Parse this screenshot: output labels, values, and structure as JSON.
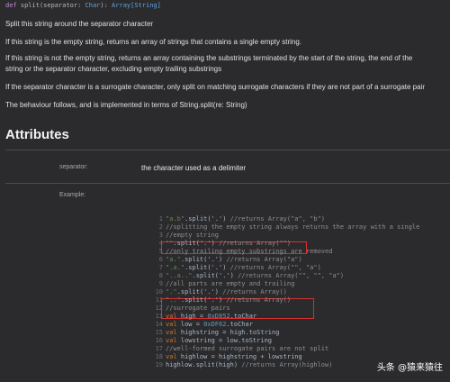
{
  "signature": {
    "keyword": "def",
    "name": "split(separator:",
    "type_a": "Char",
    "middle": "):",
    "type_b": "Array[String]"
  },
  "description": [
    "Split this string around the separator character",
    "If this string is the empty string, returns an array of strings that contains a single empty string.",
    "If this string is not the empty string, returns an array containing the substrings terminated by the start of the string, the end of the",
    "string or the separator character, excluding empty trailing substrings",
    "If the separator character is a surrogate character, only split on matching surrogate characters if they are not part of a surrogate pair",
    "The behaviour follows, and is implemented in terms of String.split(re: String)"
  ],
  "attributes_title": "Attributes",
  "attributes": [
    {
      "label": "separator:",
      "value": "the character used as a delimiter"
    },
    {
      "label": "Example:",
      "value": ""
    }
  ],
  "code_lines": [
    {
      "n": "1",
      "parts": [
        [
          "str",
          "\"a.b\""
        ],
        [
          "",
          "."
        ],
        [
          "",
          "split('.') "
        ],
        [
          "com",
          "//returns Array(\"a\", \"b\")"
        ]
      ]
    },
    {
      "n": "2",
      "parts": [
        [
          "com",
          "//splitting the empty string always returns the array with a single"
        ]
      ]
    },
    {
      "n": "3",
      "parts": [
        [
          "com",
          "//empty string"
        ]
      ]
    },
    {
      "n": "4",
      "parts": [
        [
          "str",
          "\"\""
        ],
        [
          "",
          ".split('.') "
        ],
        [
          "com",
          "//returns Array(\"\")"
        ]
      ]
    },
    {
      "n": "5",
      "parts": [
        [
          "com",
          "//only trailing empty substrings are removed"
        ]
      ]
    },
    {
      "n": "6",
      "parts": [
        [
          "str",
          "\"a.\""
        ],
        [
          "",
          ".split('.') "
        ],
        [
          "com",
          "//returns Array(\"a\")"
        ]
      ]
    },
    {
      "n": "7",
      "parts": [
        [
          "str",
          "\".a.\""
        ],
        [
          "",
          ".split('.') "
        ],
        [
          "com",
          "//returns Array(\"\", \"a\")"
        ]
      ]
    },
    {
      "n": "8",
      "parts": [
        [
          "str",
          "\"..a..\""
        ],
        [
          "",
          ".split('.') "
        ],
        [
          "com",
          "//returns Array(\"\", \"\", \"a\")"
        ]
      ]
    },
    {
      "n": "9",
      "parts": [
        [
          "com",
          "//all parts are empty and trailing"
        ]
      ]
    },
    {
      "n": "10",
      "parts": [
        [
          "str",
          "\".\""
        ],
        [
          "",
          ".split('.') "
        ],
        [
          "com",
          "//returns Array()"
        ]
      ]
    },
    {
      "n": "11",
      "parts": [
        [
          "str",
          "\"..\""
        ],
        [
          "",
          ".split('.') "
        ],
        [
          "com",
          "//returns Array()"
        ]
      ]
    },
    {
      "n": "12",
      "parts": [
        [
          "com",
          "//surrogate pairs"
        ]
      ]
    },
    {
      "n": "13",
      "parts": [
        [
          "kw",
          "val "
        ],
        [
          "",
          "high = "
        ],
        [
          "num",
          "0xD852"
        ],
        [
          "",
          ".toChar"
        ]
      ]
    },
    {
      "n": "14",
      "parts": [
        [
          "kw",
          "val "
        ],
        [
          "",
          "low = "
        ],
        [
          "num",
          "0xDF62"
        ],
        [
          "",
          ".toChar"
        ]
      ]
    },
    {
      "n": "15",
      "parts": [
        [
          "kw",
          "val "
        ],
        [
          "",
          "highstring = high.toString"
        ]
      ]
    },
    {
      "n": "16",
      "parts": [
        [
          "kw",
          "val "
        ],
        [
          "",
          "lowstring = low.toString"
        ]
      ]
    },
    {
      "n": "17",
      "parts": [
        [
          "com",
          "//well-formed surrogate pairs are not split"
        ]
      ]
    },
    {
      "n": "18",
      "parts": [
        [
          "kw",
          "val "
        ],
        [
          "",
          "highlow = highstring + lowstring"
        ]
      ]
    },
    {
      "n": "19",
      "parts": [
        [
          "",
          "highlow.split(high) "
        ],
        [
          "com",
          "//returns Array(highlow)"
        ]
      ]
    }
  ],
  "watermark": "头条 @猿来猿往"
}
